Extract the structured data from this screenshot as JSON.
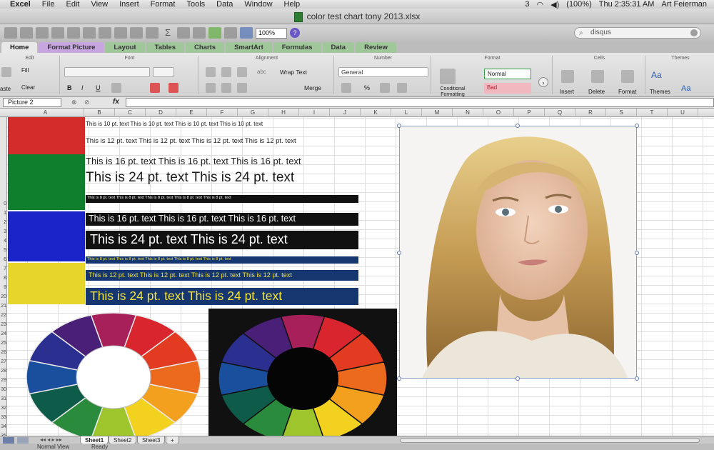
{
  "menubar": {
    "items": [
      "Excel",
      "File",
      "Edit",
      "View",
      "Insert",
      "Format",
      "Tools",
      "Data",
      "Window",
      "Help"
    ],
    "battery": "(100%)",
    "clock": "Thu 2:35:31 AM",
    "user": "Art Feierman",
    "indicator": "3"
  },
  "window": {
    "title": "color test chart tony 2013.xlsx"
  },
  "toolbar": {
    "zoom": "100%",
    "search_placeholder": "disqus",
    "sigma": "Σ",
    "help": "?"
  },
  "ribbon": {
    "tabs": [
      "Home",
      "Format Picture",
      "Layout",
      "Tables",
      "Charts",
      "SmartArt",
      "Formulas",
      "Data",
      "Review"
    ],
    "groups": {
      "edit": "Edit",
      "font": "Font",
      "alignment": "Alignment",
      "number": "Number",
      "format": "Format",
      "cells": "Cells",
      "themes": "Themes"
    },
    "fill": "Fill",
    "clear": "Clear",
    "paste": "aste",
    "wrap_text": "Wrap Text",
    "merge": "Merge",
    "number_format": "General",
    "conditional": "Conditional Formatting",
    "style_normal": "Normal",
    "style_bad": "Bad",
    "insert": "Insert",
    "delete": "Delete",
    "format_btn": "Format",
    "themes_btn": "Themes",
    "font_sample": "Aa",
    "align_abc": "abc",
    "pct": "%",
    "bold": "B",
    "italic": "I",
    "underline": "U"
  },
  "formula": {
    "name_box": "Picture 2",
    "fx": "fx"
  },
  "sheet": {
    "columns": [
      "A",
      "B",
      "C",
      "D",
      "E",
      "F",
      "G",
      "H",
      "I",
      "J",
      "K",
      "L",
      "M",
      "N",
      "O",
      "P",
      "Q",
      "R",
      "S",
      "T",
      "U"
    ],
    "rows": [
      "",
      "",
      "",
      "",
      "",
      "",
      "",
      "",
      "",
      "0",
      "1",
      "2",
      "3",
      "4",
      "5",
      "6",
      "7",
      "8",
      "9",
      "20",
      "21",
      "22",
      "23",
      "24",
      "25",
      "26",
      "27",
      "28",
      "29",
      "30",
      "31",
      "32",
      "33",
      "34",
      "35",
      "36"
    ],
    "text_rows": {
      "t10": "This is 10 pt. text  This is 10 pt. text  This is 10 pt. text  This is 10 pt. text",
      "t12": "This is 12 pt. text  This is 12 pt. text  This is 12 pt. text  This is 12 pt. text",
      "t16": "This is 16 pt. text   This is 16 pt. text   This is 16 pt. text",
      "t24": "This is 24 pt. text   This is 24 pt. text",
      "b8": "This is 8 pt. text  This is 8 pt. text  This is 8 pt. text  This is 8 pt. text  This is 8 pt. text",
      "b16": "This is 16 pt. text   This is 16 pt. text   This is 16 pt. text",
      "b24": "This is 24 pt. text   This is 24 pt. text",
      "y8": "This is 8 pt. text  This is 8 pt. text  This is 8 pt. text  This is 8 pt. text  This is 8 pt. text",
      "y12": "This is 12 pt. text  This is 12 pt. text  This is 12 pt. text  This is 12 pt. text",
      "y24": "This is 24 pt. text   This is 24 pt. text"
    },
    "swatch_colors": [
      "#d42b2b",
      "#0f7f2e",
      "#1a24c8",
      "#e6d52a"
    ],
    "wheel_colors": [
      "#a8205a",
      "#d9262e",
      "#e23b22",
      "#ec6a1d",
      "#f3a01f",
      "#f3d21f",
      "#9fc52c",
      "#2b8b3c",
      "#0e5b4a",
      "#1a4f9e",
      "#2b2f8f",
      "#4a1f78"
    ]
  },
  "sheet_tabs": [
    "Sheet1",
    "Sheet2",
    "Sheet3",
    "+"
  ],
  "status": {
    "view": "Normal View",
    "ready": "Ready"
  }
}
